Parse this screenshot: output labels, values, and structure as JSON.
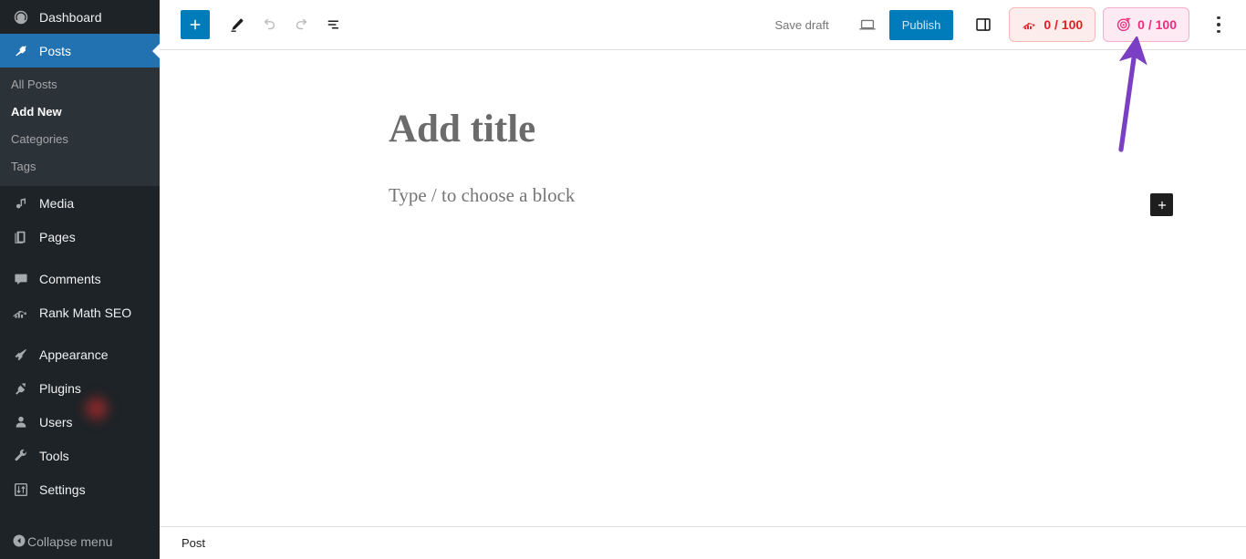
{
  "admin_sidebar": {
    "items": [
      {
        "label": "Dashboard",
        "icon": "dashboard-icon",
        "current": false
      },
      {
        "label": "Posts",
        "icon": "pin-icon",
        "current": true
      },
      {
        "label": "Media",
        "icon": "media-icon",
        "current": false
      },
      {
        "label": "Pages",
        "icon": "pages-icon",
        "current": false
      },
      {
        "label": "Comments",
        "icon": "comments-icon",
        "current": false
      },
      {
        "label": "Rank Math SEO",
        "icon": "rank-math-icon",
        "current": false
      },
      {
        "label": "Appearance",
        "icon": "appearance-brush-icon",
        "current": false
      },
      {
        "label": "Plugins",
        "icon": "plugins-plug-icon",
        "current": false
      },
      {
        "label": "Users",
        "icon": "users-icon",
        "current": false
      },
      {
        "label": "Tools",
        "icon": "tools-wrench-icon",
        "current": false
      },
      {
        "label": "Settings",
        "icon": "settings-sliders-icon",
        "current": false
      }
    ],
    "posts_submenu": [
      {
        "label": "All Posts",
        "current": false
      },
      {
        "label": "Add New",
        "current": true
      },
      {
        "label": "Categories",
        "current": false
      },
      {
        "label": "Tags",
        "current": false
      }
    ],
    "collapse": {
      "label": "Collapse menu",
      "icon": "collapse-arrow-icon"
    },
    "colors": {
      "background": "#1d2327",
      "submenu_background": "#2c3338",
      "active": "#2271b1",
      "text": "#f0f0f1",
      "muted_text": "#a7aaad"
    }
  },
  "editor_header": {
    "add_block": {
      "label": "+",
      "icon": "plus-icon"
    },
    "tools": {
      "icon": "pencil-icon"
    },
    "undo": {
      "icon": "undo-icon",
      "disabled": true
    },
    "redo": {
      "icon": "redo-icon",
      "disabled": true
    },
    "list_view": {
      "icon": "document-overview-icon"
    },
    "save_draft_label": "Save draft",
    "preview": {
      "icon": "preview-laptop-icon"
    },
    "publish_label": "Publish",
    "settings_sidebar": {
      "icon": "sidebar-panel-icon"
    },
    "seo_score_badge": {
      "value": "0 / 100",
      "icon": "rank-math-icon",
      "color": "#e02121",
      "background": "#fdecec"
    },
    "ai_score_badge": {
      "value": "0 / 100",
      "icon": "content-ai-icon",
      "color": "#ea2f7e",
      "background": "#fdeaf2"
    },
    "more_menu": {
      "icon": "kebab-menu-icon"
    },
    "publish_button_color": "#007cba"
  },
  "canvas": {
    "title_placeholder": "Add title",
    "block_placeholder": "Type / to choose a block",
    "block_inserter": {
      "label": "+",
      "icon": "plus-icon"
    }
  },
  "statusbar": {
    "breadcrumb": "Post"
  },
  "annotation": {
    "arrow_color": "#7b3fc4",
    "points_to": "ai_score_badge"
  }
}
